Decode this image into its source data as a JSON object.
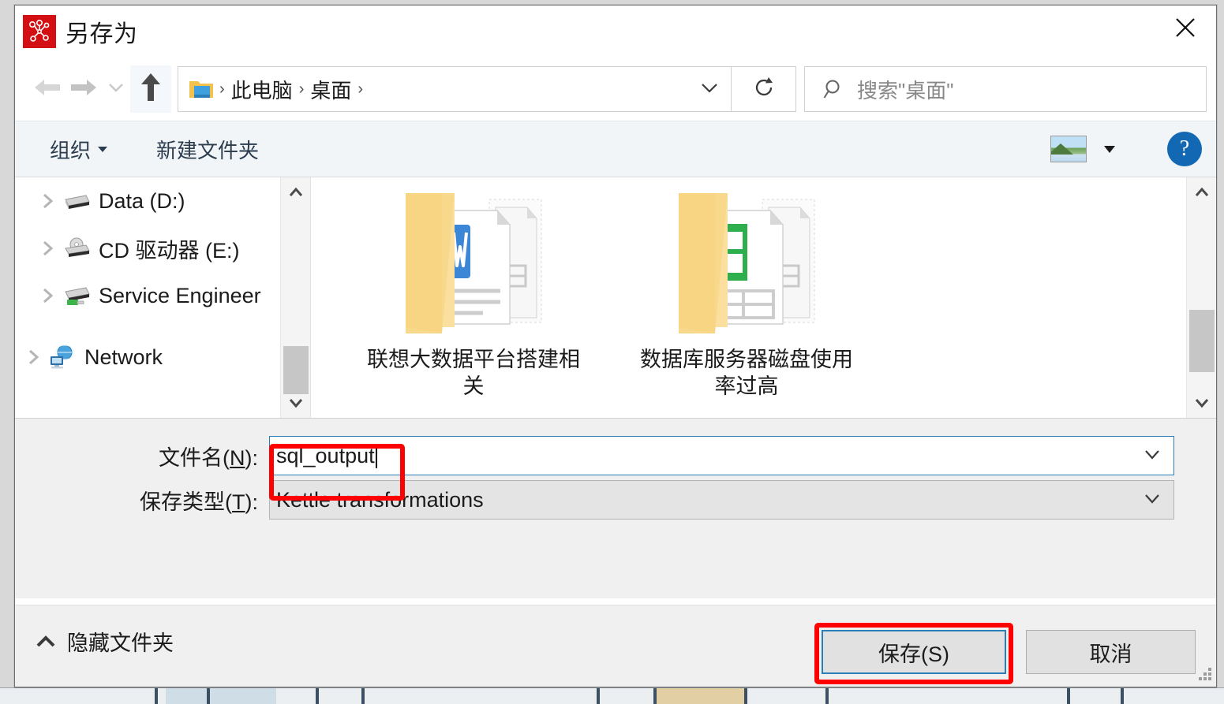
{
  "window": {
    "title": "另存为",
    "app_icon": "kettle-logo-icon",
    "close_icon": "close-icon",
    "accent_blue": "#2a7fb8",
    "annotation_red": "#ff0000",
    "logo_red": "#d40f14"
  },
  "navbar": {
    "back_icon": "back-arrow-icon",
    "forward_icon": "forward-arrow-icon",
    "recent_icon": "chevron-down-icon",
    "up_icon": "up-arrow-icon",
    "address_folder_icon": "desktop-folder-icon",
    "breadcrumbs": [
      "此电脑",
      "桌面"
    ],
    "breadcrumb_separator": "›",
    "address_dropdown_icon": "chevron-down-icon",
    "refresh_icon": "refresh-icon",
    "search_icon": "search-icon",
    "search_placeholder": "搜索\"桌面\"",
    "search_value": ""
  },
  "commandbar": {
    "organize_label": "组织",
    "new_folder_label": "新建文件夹",
    "view_icon": "picture-view-icon",
    "view_caret_icon": "chevron-down-icon",
    "help_label": "?",
    "help_icon": "help-icon"
  },
  "nav_pane": {
    "items": [
      {
        "label": "Data (D:)",
        "icon": "hard-drive-icon",
        "level": 1,
        "expander": "chevron-right-icon"
      },
      {
        "label": "CD 驱动器 (E:)",
        "icon": "cd-drive-icon",
        "level": 1,
        "expander": "chevron-right-icon"
      },
      {
        "label": "Service Engineer",
        "icon": "usb-drive-icon",
        "level": 1,
        "expander": "chevron-right-icon"
      },
      {
        "label": "Network",
        "icon": "network-icon",
        "level": 0,
        "expander": "chevron-right-icon"
      }
    ],
    "scrollbar": {
      "up_icon": "scroll-up-icon",
      "down_icon": "scroll-down-icon",
      "thumb_top_pct": 70,
      "thumb_height_pct": 20
    }
  },
  "file_pane": {
    "items": [
      {
        "label": "联想大数据平台搭建相关",
        "icon": "folder-with-word-doc-icon"
      },
      {
        "label": "数据库服务器磁盘使用率过高",
        "icon": "folder-with-excel-doc-icon"
      }
    ],
    "scrollbar": {
      "up_icon": "scroll-up-icon",
      "down_icon": "scroll-down-icon",
      "thumb_top_pct": 55,
      "thumb_height_pct": 26
    }
  },
  "form": {
    "filename_label_prefix": "文件名(",
    "filename_label_key": "N",
    "filename_label_suffix": "):",
    "filename_value": "sql_output",
    "filename_dropdown_icon": "chevron-down-icon",
    "filetype_label_prefix": "保存类型(",
    "filetype_label_key": "T",
    "filetype_label_suffix": "):",
    "filetype_value": "Kettle transformations",
    "filetype_dropdown_icon": "chevron-down-icon"
  },
  "footer": {
    "hide_folders_label": "隐藏文件夹",
    "hide_folders_icon": "chevron-up-icon",
    "save_label": "保存(S)",
    "cancel_label": "取消",
    "resize_grip_icon": "resize-grip-icon"
  }
}
